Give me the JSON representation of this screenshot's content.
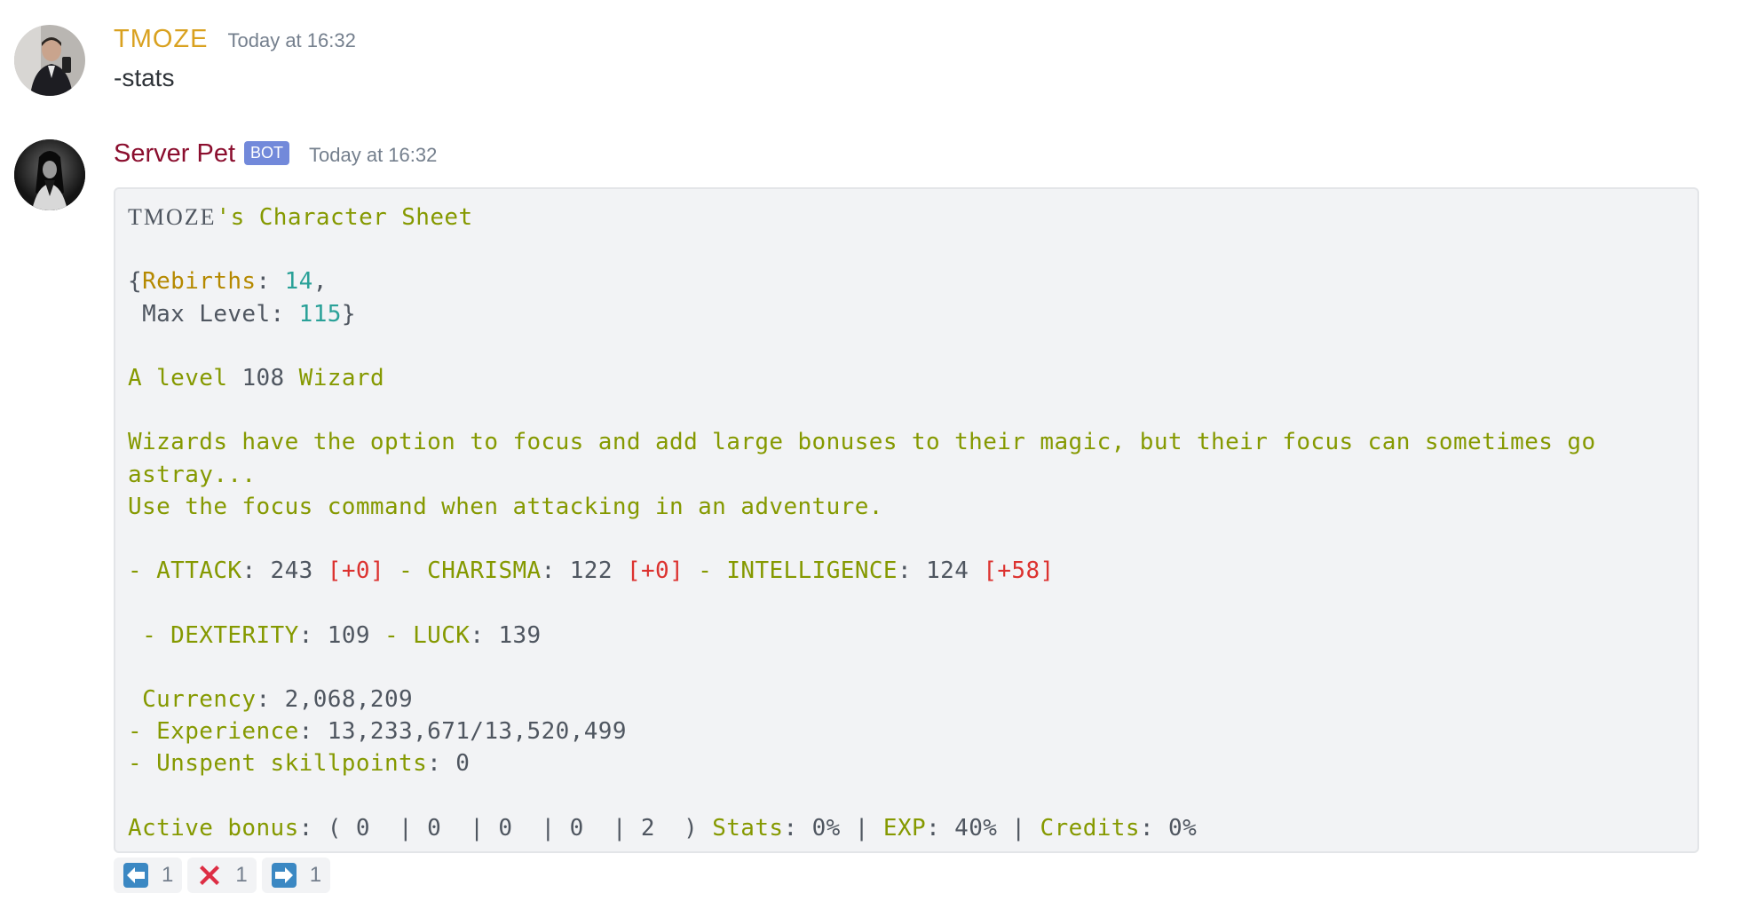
{
  "messages": [
    {
      "author": "TMOZE",
      "author_color": "#d9a11f",
      "timestamp": "Today at 16:32",
      "content": "-stats",
      "avatar_icon": "user-avatar-photo"
    },
    {
      "author": "Server Pet",
      "author_color": "#8b0e2e",
      "badge": "BOT",
      "timestamp": "Today at 16:32",
      "avatar_icon": "bot-avatar-photo",
      "codeblock": {
        "title_name": "TMOZE",
        "title_rest": "'s Character Sheet",
        "rebirths_label": "Rebirths",
        "rebirths_value": "14",
        "max_level_label": "Max Level",
        "max_level_value": "115",
        "level_prefix": "A level",
        "level_value": "108",
        "class_name": "Wizard",
        "description_line1": "Wizards have the option to focus and add large bonuses to their magic, but their focus can sometimes go",
        "description_line2": "astray...",
        "description_line3": "Use the focus command when attacking in an adventure.",
        "stats": {
          "attack_label": "ATTACK",
          "attack_value": "243",
          "attack_bonus": "[+0]",
          "charisma_label": "CHARISMA",
          "charisma_value": "122",
          "charisma_bonus": "[+0]",
          "intelligence_label": "INTELLIGENCE",
          "intelligence_value": "124",
          "intelligence_bonus": "[+58]",
          "dexterity_label": "DEXTERITY",
          "dexterity_value": "109",
          "luck_label": "LUCK",
          "luck_value": "139"
        },
        "currency_label": "Currency",
        "currency_value": "2,068,209",
        "experience_label": "Experience",
        "experience_value": "13,233,671/13,520,499",
        "skillpoints_label": "Unspent skillpoints",
        "skillpoints_value": "0",
        "active_bonus_label": "Active bonus",
        "active_bonus_values": "( 0  | 0  | 0  | 0  | 2  )",
        "stats_pct_label": "Stats",
        "stats_pct_value": "0%",
        "exp_pct_label": "EXP",
        "exp_pct_value": "40%",
        "credits_pct_label": "Credits",
        "credits_pct_value": "0%"
      },
      "reactions": [
        {
          "icon": "arrow-left-icon",
          "count": "1"
        },
        {
          "icon": "red-x-icon",
          "count": "1"
        },
        {
          "icon": "arrow-right-icon",
          "count": "1"
        }
      ]
    }
  ],
  "colors": {
    "code_green": "#859900",
    "code_orange": "#b58900",
    "code_cyan": "#2aa198",
    "code_red": "#dc322f",
    "bot_badge": "#7289da",
    "emoji_blue": "#3b88c3",
    "emoji_red": "#dd2e44"
  }
}
